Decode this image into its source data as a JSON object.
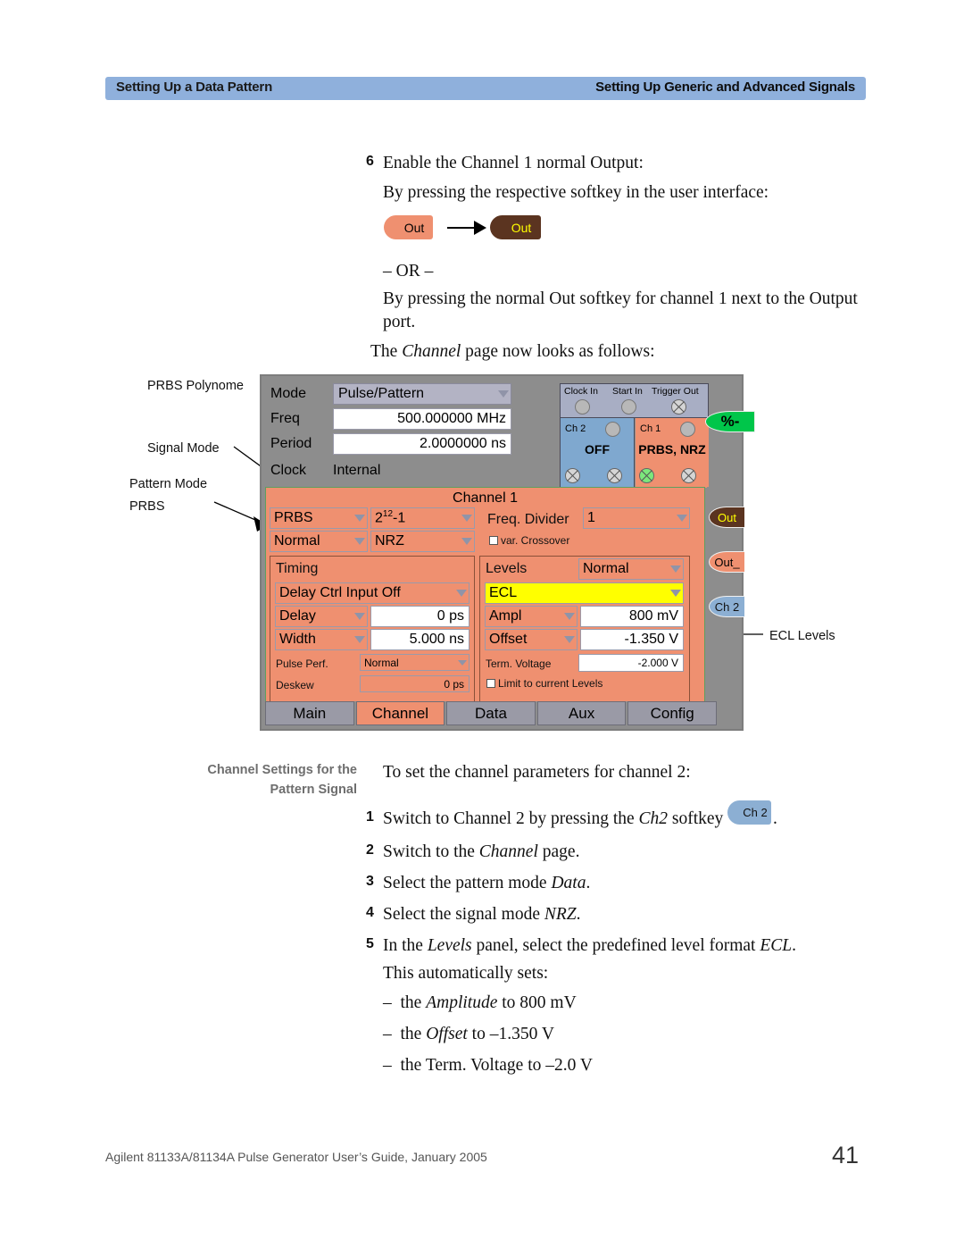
{
  "header": {
    "left": "Setting Up a Data Pattern",
    "right": "Setting Up Generic and Advanced Signals",
    "band_color": "#8fb0dc"
  },
  "body": {
    "step6_num": "6",
    "step6_text": "Enable the Channel 1 normal Output:",
    "line_softkey": "By pressing the respective softkey in the user interface:",
    "or_text": "– OR –",
    "line_port_1": "By pressing the normal Out softkey for channel 1 next to the Output",
    "line_port_2": "port.",
    "line_channel_page": "The Channel page now looks as follows:",
    "out_off_label": "Out",
    "out_on_label": "Out"
  },
  "annotations": {
    "prbs_polynome": "PRBS Polynome",
    "signal_mode": "Signal Mode",
    "pattern_mode_1": "Pattern Mode",
    "pattern_mode_2": "PRBS",
    "ecl_levels": "ECL Levels"
  },
  "instrument": {
    "mode_label": "Mode",
    "mode_value": "Pulse/Pattern",
    "freq_label": "Freq",
    "freq_value": "500.000000 MHz",
    "period_label": "Period",
    "period_value": "2.0000000 ns",
    "clock_label": "Clock",
    "clock_value": "Internal",
    "connectors": {
      "clock_in": "Clock In",
      "start_in": "Start In",
      "trigger_out": "Trigger Out",
      "ch2_name": "Ch 2",
      "ch2_state": "OFF",
      "ch1_name": "Ch 1",
      "ch1_state": "PRBS, NRZ"
    },
    "percent_key": "%-",
    "channel_title": "Channel 1",
    "pattern_mode": "PRBS",
    "polynome": "2¹²-1",
    "polynome_base": "2",
    "polynome_exp": "12",
    "polynome_tail": "-1",
    "polarity": "Normal",
    "signal_mode": "NRZ",
    "freq_divider_label": "Freq. Divider",
    "freq_divider_value": "1",
    "var_crossover": "var. Crossover",
    "timing_title": "Timing",
    "delay_ctrl": "Delay Ctrl Input Off",
    "delay_label": "Delay",
    "delay_value": "0 ps",
    "width_label": "Width",
    "width_value": "5.000 ns",
    "pulse_perf_label": "Pulse Perf.",
    "pulse_perf_value": "Normal",
    "deskew_label": "Deskew",
    "deskew_value": "0 ps",
    "levels_title": "Levels",
    "levels_mode": "Normal",
    "level_format": "ECL",
    "ampl_label": "Ampl",
    "ampl_value": "800 mV",
    "offset_label": "Offset",
    "offset_value": "-1.350 V",
    "term_voltage_label": "Term. Voltage",
    "term_voltage_value": "-2.000 V",
    "limit_levels": "Limit to current Levels",
    "softkeys": {
      "out": "Out",
      "out_neg": "Out_",
      "ch2": "Ch 2"
    },
    "tabs": [
      {
        "label": "Main",
        "active": false
      },
      {
        "label": "Channel",
        "active": true
      },
      {
        "label": "Data",
        "active": false
      },
      {
        "label": "Aux",
        "active": false
      },
      {
        "label": "Config",
        "active": false
      }
    ],
    "colors": {
      "channel_orange": "#ef9070",
      "channel_blue": "#7fa8cf",
      "highlight_yellow": "#ffff00",
      "enabled_green": "#7ce87c",
      "panel_gray": "#8d8d8d"
    }
  },
  "section": {
    "side_head_1": "Channel Settings for the",
    "side_head_2": "Pattern Signal",
    "intro": "To set the channel parameters for channel 2:",
    "steps": [
      {
        "num": "1",
        "pre": "Switch to Channel 2 by pressing the ",
        "em": "Ch2",
        "post": " softkey",
        "pill": "Ch 2",
        "tail": "."
      },
      {
        "num": "2",
        "pre": "Switch to the ",
        "em": "Channel",
        "post": " page."
      },
      {
        "num": "3",
        "pre": "Select the pattern mode ",
        "em": "Data",
        "post": "."
      },
      {
        "num": "4",
        "pre": "Select the signal mode ",
        "em": "NRZ",
        "post": "."
      },
      {
        "num": "5",
        "pre": "In the ",
        "em": "Levels",
        "post": " panel, select the predefined level format ",
        "em2": "ECL",
        "post2": "."
      }
    ],
    "auto_sets": "This automatically sets:",
    "bullets": [
      {
        "dash": "–",
        "pre": "the ",
        "em": "Amplitude",
        "post": " to 800 mV"
      },
      {
        "dash": "–",
        "pre": "the ",
        "em": "Offset",
        "post": " to –1.350 V"
      },
      {
        "dash": "–",
        "pre": "the ",
        "em": "",
        "post": "Term. Voltage to –2.0 V",
        "plain": "the Term. Voltage to –2.0 V"
      }
    ]
  },
  "footer": {
    "text": "Agilent 81133A/81134A Pulse Generator User’s Guide, January 2005",
    "page": "41"
  }
}
